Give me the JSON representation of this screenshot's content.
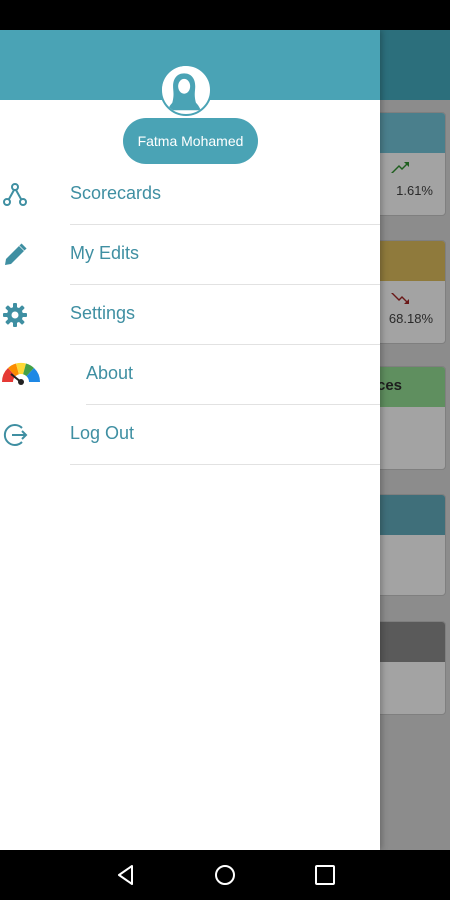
{
  "drawer": {
    "user_name": "Fatma Mohamed",
    "header_color": "#4aa3b5",
    "items": [
      {
        "label": "Scorecards",
        "icon": "scorecards-icon"
      },
      {
        "label": "My Edits",
        "icon": "pencil-icon"
      },
      {
        "label": "Settings",
        "icon": "gear-icon"
      },
      {
        "label": "About",
        "icon": "gauge-icon"
      },
      {
        "label": "Log Out",
        "icon": "logout-icon"
      }
    ]
  },
  "background": {
    "cards": [
      {
        "value": "1.61%",
        "status": "up",
        "band_color": "#4a7f8c"
      },
      {
        "value": "68.18%",
        "status": "down",
        "band_color": "#8f7a3c"
      },
      {
        "title_fragment": "ces",
        "band_color": "#5f8f5f"
      },
      {
        "band_color": "#3f6f7a"
      },
      {
        "band_color": "#5a5a5a"
      }
    ]
  },
  "nav_bar": {
    "buttons": [
      "back-icon",
      "home-icon",
      "recents-icon"
    ]
  }
}
